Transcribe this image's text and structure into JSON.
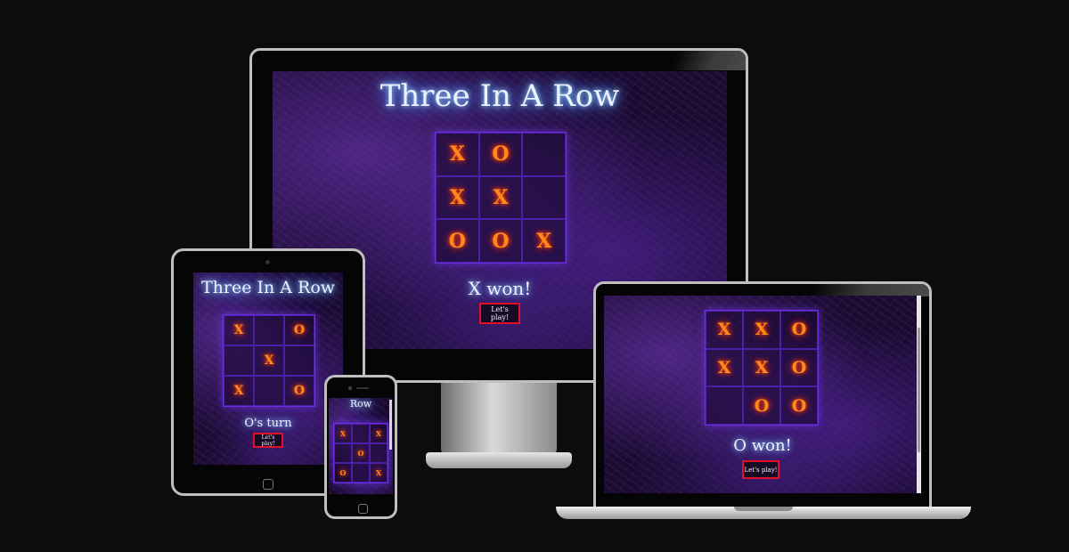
{
  "desktop": {
    "title": "Three In A Row",
    "board": [
      "X",
      "O",
      "",
      "X",
      "X",
      "",
      "O",
      "O",
      "X"
    ],
    "status": "X won!",
    "button": "Let's play!"
  },
  "tablet": {
    "title": "Three In A Row",
    "board": [
      "X",
      "",
      "O",
      "",
      "X",
      "",
      "X",
      "",
      "O"
    ],
    "status": "O's turn",
    "button": "Let's play!"
  },
  "phone": {
    "title": "Row",
    "board": [
      "X",
      "",
      "X",
      "",
      "O",
      "",
      "O",
      "",
      "X"
    ]
  },
  "laptop": {
    "board": [
      "X",
      "X",
      "O",
      "X",
      "X",
      "O",
      "",
      "O",
      "O"
    ],
    "status": "O won!",
    "button": "Let's play!"
  },
  "colors": {
    "bezel": "#050505",
    "frame": "#bfbfbf",
    "board_border": "#6b2de0",
    "mark": "#ff8a1c",
    "button_border": "#e0102a",
    "title_glow": "#5aa9ff"
  }
}
